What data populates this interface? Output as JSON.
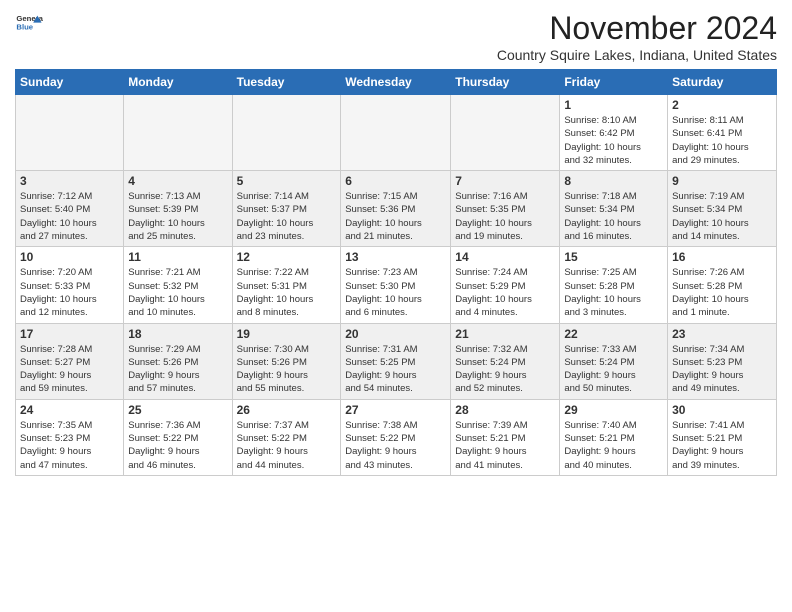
{
  "logo": {
    "line1": "General",
    "line2": "Blue"
  },
  "title": "November 2024",
  "location": "Country Squire Lakes, Indiana, United States",
  "weekdays": [
    "Sunday",
    "Monday",
    "Tuesday",
    "Wednesday",
    "Thursday",
    "Friday",
    "Saturday"
  ],
  "weeks": [
    [
      {
        "day": "",
        "info": ""
      },
      {
        "day": "",
        "info": ""
      },
      {
        "day": "",
        "info": ""
      },
      {
        "day": "",
        "info": ""
      },
      {
        "day": "",
        "info": ""
      },
      {
        "day": "1",
        "info": "Sunrise: 8:10 AM\nSunset: 6:42 PM\nDaylight: 10 hours\nand 32 minutes."
      },
      {
        "day": "2",
        "info": "Sunrise: 8:11 AM\nSunset: 6:41 PM\nDaylight: 10 hours\nand 29 minutes."
      }
    ],
    [
      {
        "day": "3",
        "info": "Sunrise: 7:12 AM\nSunset: 5:40 PM\nDaylight: 10 hours\nand 27 minutes."
      },
      {
        "day": "4",
        "info": "Sunrise: 7:13 AM\nSunset: 5:39 PM\nDaylight: 10 hours\nand 25 minutes."
      },
      {
        "day": "5",
        "info": "Sunrise: 7:14 AM\nSunset: 5:37 PM\nDaylight: 10 hours\nand 23 minutes."
      },
      {
        "day": "6",
        "info": "Sunrise: 7:15 AM\nSunset: 5:36 PM\nDaylight: 10 hours\nand 21 minutes."
      },
      {
        "day": "7",
        "info": "Sunrise: 7:16 AM\nSunset: 5:35 PM\nDaylight: 10 hours\nand 19 minutes."
      },
      {
        "day": "8",
        "info": "Sunrise: 7:18 AM\nSunset: 5:34 PM\nDaylight: 10 hours\nand 16 minutes."
      },
      {
        "day": "9",
        "info": "Sunrise: 7:19 AM\nSunset: 5:34 PM\nDaylight: 10 hours\nand 14 minutes."
      }
    ],
    [
      {
        "day": "10",
        "info": "Sunrise: 7:20 AM\nSunset: 5:33 PM\nDaylight: 10 hours\nand 12 minutes."
      },
      {
        "day": "11",
        "info": "Sunrise: 7:21 AM\nSunset: 5:32 PM\nDaylight: 10 hours\nand 10 minutes."
      },
      {
        "day": "12",
        "info": "Sunrise: 7:22 AM\nSunset: 5:31 PM\nDaylight: 10 hours\nand 8 minutes."
      },
      {
        "day": "13",
        "info": "Sunrise: 7:23 AM\nSunset: 5:30 PM\nDaylight: 10 hours\nand 6 minutes."
      },
      {
        "day": "14",
        "info": "Sunrise: 7:24 AM\nSunset: 5:29 PM\nDaylight: 10 hours\nand 4 minutes."
      },
      {
        "day": "15",
        "info": "Sunrise: 7:25 AM\nSunset: 5:28 PM\nDaylight: 10 hours\nand 3 minutes."
      },
      {
        "day": "16",
        "info": "Sunrise: 7:26 AM\nSunset: 5:28 PM\nDaylight: 10 hours\nand 1 minute."
      }
    ],
    [
      {
        "day": "17",
        "info": "Sunrise: 7:28 AM\nSunset: 5:27 PM\nDaylight: 9 hours\nand 59 minutes."
      },
      {
        "day": "18",
        "info": "Sunrise: 7:29 AM\nSunset: 5:26 PM\nDaylight: 9 hours\nand 57 minutes."
      },
      {
        "day": "19",
        "info": "Sunrise: 7:30 AM\nSunset: 5:26 PM\nDaylight: 9 hours\nand 55 minutes."
      },
      {
        "day": "20",
        "info": "Sunrise: 7:31 AM\nSunset: 5:25 PM\nDaylight: 9 hours\nand 54 minutes."
      },
      {
        "day": "21",
        "info": "Sunrise: 7:32 AM\nSunset: 5:24 PM\nDaylight: 9 hours\nand 52 minutes."
      },
      {
        "day": "22",
        "info": "Sunrise: 7:33 AM\nSunset: 5:24 PM\nDaylight: 9 hours\nand 50 minutes."
      },
      {
        "day": "23",
        "info": "Sunrise: 7:34 AM\nSunset: 5:23 PM\nDaylight: 9 hours\nand 49 minutes."
      }
    ],
    [
      {
        "day": "24",
        "info": "Sunrise: 7:35 AM\nSunset: 5:23 PM\nDaylight: 9 hours\nand 47 minutes."
      },
      {
        "day": "25",
        "info": "Sunrise: 7:36 AM\nSunset: 5:22 PM\nDaylight: 9 hours\nand 46 minutes."
      },
      {
        "day": "26",
        "info": "Sunrise: 7:37 AM\nSunset: 5:22 PM\nDaylight: 9 hours\nand 44 minutes."
      },
      {
        "day": "27",
        "info": "Sunrise: 7:38 AM\nSunset: 5:22 PM\nDaylight: 9 hours\nand 43 minutes."
      },
      {
        "day": "28",
        "info": "Sunrise: 7:39 AM\nSunset: 5:21 PM\nDaylight: 9 hours\nand 41 minutes."
      },
      {
        "day": "29",
        "info": "Sunrise: 7:40 AM\nSunset: 5:21 PM\nDaylight: 9 hours\nand 40 minutes."
      },
      {
        "day": "30",
        "info": "Sunrise: 7:41 AM\nSunset: 5:21 PM\nDaylight: 9 hours\nand 39 minutes."
      }
    ]
  ]
}
